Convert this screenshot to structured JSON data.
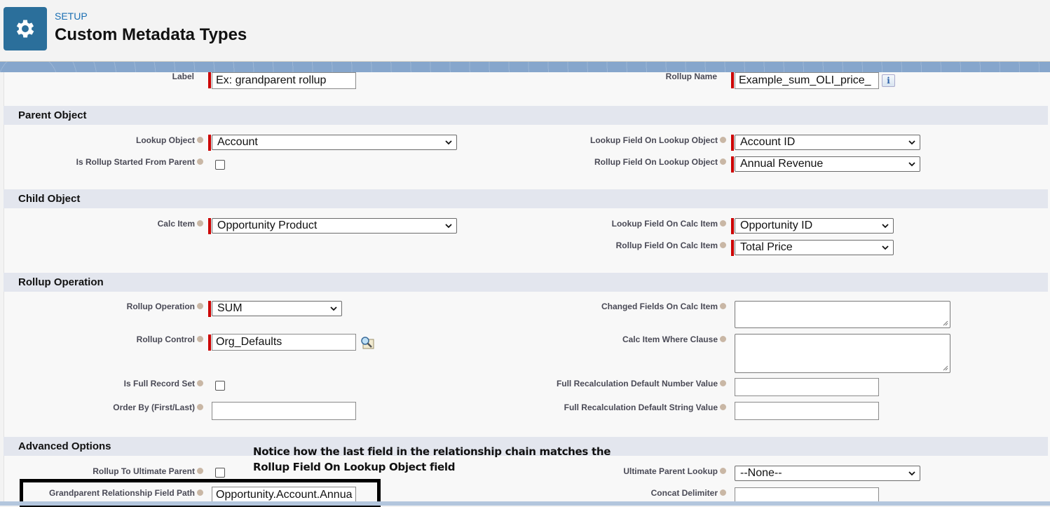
{
  "header": {
    "breadcrumb": "SETUP",
    "title": "Custom Metadata Types",
    "icon": "gear-icon"
  },
  "top_fields": {
    "label": {
      "label": "Label",
      "value": "Ex: grandparent rollup"
    },
    "rollup_name": {
      "label": "Rollup Name",
      "value": "Example_sum_OLI_price_",
      "info": "i"
    }
  },
  "sections": {
    "parent": {
      "title": "Parent Object",
      "lookup_object": {
        "label": "Lookup Object",
        "value": "Account"
      },
      "is_rollup_started_from_parent": {
        "label": "Is Rollup Started From Parent",
        "checked": false
      },
      "lookup_field_on_lookup_object": {
        "label": "Lookup Field On Lookup Object",
        "value": "Account ID"
      },
      "rollup_field_on_lookup_object": {
        "label": "Rollup Field On Lookup Object",
        "value": "Annual Revenue"
      }
    },
    "child": {
      "title": "Child Object",
      "calc_item": {
        "label": "Calc Item",
        "value": "Opportunity Product"
      },
      "lookup_field_on_calc_item": {
        "label": "Lookup Field On Calc Item",
        "value": "Opportunity ID"
      },
      "rollup_field_on_calc_item": {
        "label": "Rollup Field On Calc Item",
        "value": "Total Price"
      }
    },
    "operation": {
      "title": "Rollup Operation",
      "rollup_operation": {
        "label": "Rollup Operation",
        "value": "SUM"
      },
      "rollup_control": {
        "label": "Rollup Control",
        "value": "Org_Defaults"
      },
      "is_full_record_set": {
        "label": "Is Full Record Set",
        "checked": false
      },
      "order_by": {
        "label": "Order By (First/Last)",
        "value": ""
      },
      "changed_fields_on_calc_item": {
        "label": "Changed Fields On Calc Item",
        "value": ""
      },
      "calc_item_where_clause": {
        "label": "Calc Item Where Clause",
        "value": ""
      },
      "full_recalc_default_number": {
        "label": "Full Recalculation Default Number Value",
        "value": ""
      },
      "full_recalc_default_string": {
        "label": "Full Recalculation Default String Value",
        "value": ""
      }
    },
    "advanced": {
      "title": "Advanced Options",
      "rollup_to_ultimate_parent": {
        "label": "Rollup To Ultimate Parent",
        "checked": false
      },
      "grandparent_relationship_field_path": {
        "label": "Grandparent Relationship Field Path",
        "value": "Opportunity.Account.Annua"
      },
      "ultimate_parent_lookup": {
        "label": "Ultimate Parent Lookup",
        "value": "--None--"
      },
      "concat_delimiter": {
        "label": "Concat Delimiter",
        "value": ""
      }
    }
  },
  "annotation": {
    "line1": "Notice how the last field in the relationship chain matches the",
    "line2": "Rollup Field On Lookup Object field"
  },
  "colors": {
    "brand_blue": "#2b6f9b",
    "required_red": "#cc0000",
    "section_bg": "#e3e6ee"
  }
}
